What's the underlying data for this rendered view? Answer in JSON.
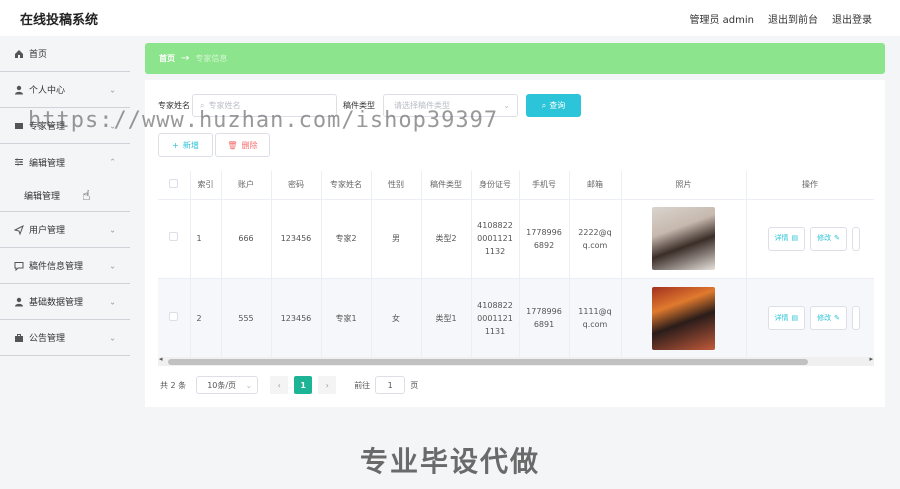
{
  "app": {
    "title": "在线投稿系统"
  },
  "topnav": {
    "admin": "管理员 admin",
    "front": "退出到前台",
    "logout": "退出登录"
  },
  "sidebar": {
    "items": [
      {
        "label": "首页",
        "icon": "home-icon",
        "chevron": false
      },
      {
        "label": "个人中心",
        "icon": "user-icon",
        "chevron": true
      },
      {
        "label": "专家管理",
        "icon": "folder-icon",
        "chevron": true
      },
      {
        "label": "编辑管理",
        "icon": "sliders-icon",
        "chevron": true,
        "expanded": true,
        "sub": "编辑管理"
      },
      {
        "label": "用户管理",
        "icon": "send-icon",
        "chevron": true
      },
      {
        "label": "稿件信息管理",
        "icon": "chat-icon",
        "chevron": true
      },
      {
        "label": "基础数据管理",
        "icon": "user-icon",
        "chevron": true
      },
      {
        "label": "公告管理",
        "icon": "briefcase-icon",
        "chevron": true
      }
    ]
  },
  "breadcrumb": {
    "home": "首页",
    "sep": "→",
    "current": "专家信息"
  },
  "search": {
    "name_label": "专家姓名",
    "name_placeholder": "专家姓名",
    "type_label": "稿件类型",
    "type_placeholder": "请选择稿件类型",
    "button": "查询"
  },
  "actions": {
    "add": "新增",
    "delete": "删除"
  },
  "table": {
    "headers": [
      "",
      "索引",
      "账户",
      "密码",
      "专家姓名",
      "性别",
      "稿件类型",
      "身份证号",
      "手机号",
      "邮箱",
      "照片",
      "操作"
    ],
    "rows": [
      {
        "index": "1",
        "account": "666",
        "password": "123456",
        "name": "专家2",
        "gender": "男",
        "type": "类型2",
        "idcard": "4108822 0001121 1132",
        "phone": "1778996 6892",
        "email": "2222@q q.com"
      },
      {
        "index": "2",
        "account": "555",
        "password": "123456",
        "name": "专家1",
        "gender": "女",
        "type": "类型1",
        "idcard": "4108822 0001121 1131",
        "phone": "1778996 6891",
        "email": "1111@q q.com"
      }
    ],
    "detail_label": "详情",
    "edit_label": "修改"
  },
  "pagination": {
    "total": "共 2 条",
    "page_size": "10条/页",
    "current": "1",
    "goto_label": "前往",
    "goto_value": "1",
    "page_unit": "页"
  },
  "overlay": {
    "watermark": "https://www.huzhan.com/ishop39397",
    "footer": "专业毕设代做"
  }
}
